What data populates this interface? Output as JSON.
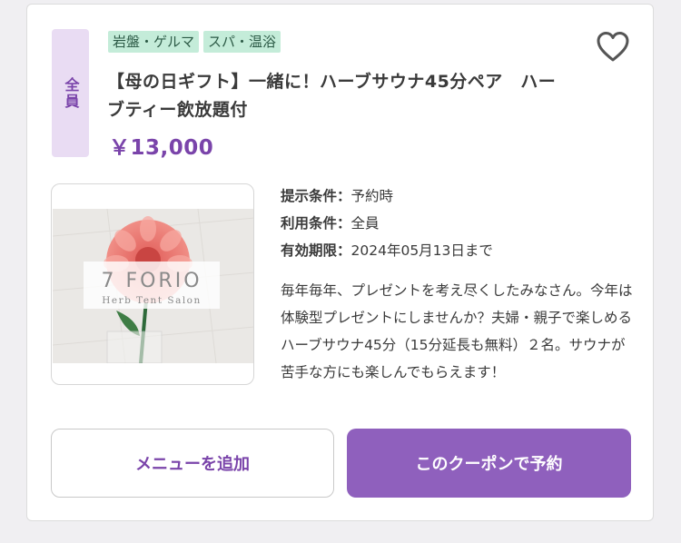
{
  "coupon": {
    "target": "全員",
    "tags": [
      "岩盤・ゲルマ",
      "スパ・温浴"
    ],
    "title": "【母の日ギフト】一緒に！ハーブサウナ45分ペア　ハーブティー飲放題付",
    "price": "￥13,000",
    "meta": [
      {
        "label": "提示条件：",
        "value": "予約時"
      },
      {
        "label": "利用条件：",
        "value": "全員"
      },
      {
        "label": "有効期限：",
        "value": "2024年05月13日まで"
      }
    ],
    "description": "毎年毎年、プレゼントを考え尽くしたみなさん。今年は体験型プレゼントにしませんか？夫婦・親子で楽しめるハーブサウナ45分（15分延長も無料）２名。サウナが苦手な方にも楽しんでもらえます！",
    "image": {
      "logo_text": "7 FORIO",
      "logo_sub": "Herb Tent Salon"
    }
  },
  "buttons": {
    "add_menu": "メニューを追加",
    "reserve": "このクーポンで予約"
  },
  "icons": {
    "favorite": "heart-outline-icon"
  },
  "colors": {
    "accent": "#7a44aa",
    "button": "#8f60bd",
    "tag_bg": "#c4ecd9",
    "badge_bg": "#e9dcf3"
  }
}
